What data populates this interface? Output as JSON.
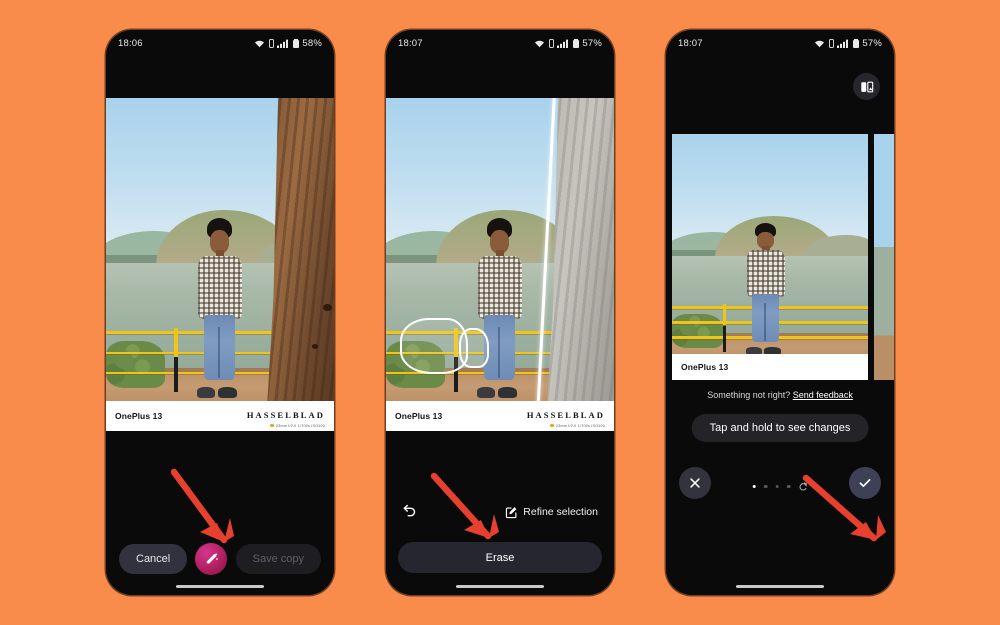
{
  "background_color": "#F98C4B",
  "phones": [
    {
      "id": "phone-1",
      "name": "ai-eraser-initial",
      "status": {
        "time": "18:06",
        "battery": "58%",
        "wifi_icon": "wifi-icon",
        "sim_icon": "sim-icon",
        "signal_icon": "signal-bars-icon",
        "battery_icon": "battery-icon"
      },
      "watermark": {
        "device": "OnePlus 13",
        "brand": "HASSELBLAD",
        "exif": "23mm f/2.0 1/700s ISO100"
      },
      "controls": {
        "cancel_label": "Cancel",
        "save_label": "Save copy",
        "magic_icon": "magic-wand-icon"
      }
    },
    {
      "id": "phone-2",
      "name": "ai-eraser-selection",
      "status": {
        "time": "18:07",
        "battery": "57%",
        "wifi_icon": "wifi-icon",
        "sim_icon": "sim-icon",
        "signal_icon": "signal-bars-icon",
        "battery_icon": "battery-icon"
      },
      "watermark": {
        "device": "OnePlus 13",
        "brand": "HASSELBLAD",
        "exif": "23mm f/2.0 1/700s ISO100"
      },
      "controls": {
        "undo_icon": "undo-icon",
        "refine_icon": "edit-square-icon",
        "refine_label": "Refine selection",
        "erase_label": "Erase"
      }
    },
    {
      "id": "phone-3",
      "name": "ai-eraser-result",
      "status": {
        "time": "18:07",
        "battery": "57%",
        "wifi_icon": "wifi-icon",
        "sim_icon": "sim-icon",
        "signal_icon": "signal-bars-icon",
        "battery_icon": "battery-icon"
      },
      "watermark": {
        "device": "OnePlus 13"
      },
      "compare_icon": "compare-images-icon",
      "controls": {
        "feedback_prefix": "Something not right?",
        "feedback_link": "Send feedback",
        "taphold_label": "Tap and hold to see changes",
        "close_icon": "close-icon",
        "confirm_icon": "check-icon",
        "refresh_icon": "refresh-icon",
        "dots_total": 4,
        "dots_active_index": 0
      }
    }
  ],
  "annotations": [
    {
      "name": "arrow-to-magic-wand",
      "color": "#e8402f"
    },
    {
      "name": "arrow-to-erase",
      "color": "#e8402f"
    },
    {
      "name": "arrow-to-confirm",
      "color": "#e8402f"
    }
  ]
}
